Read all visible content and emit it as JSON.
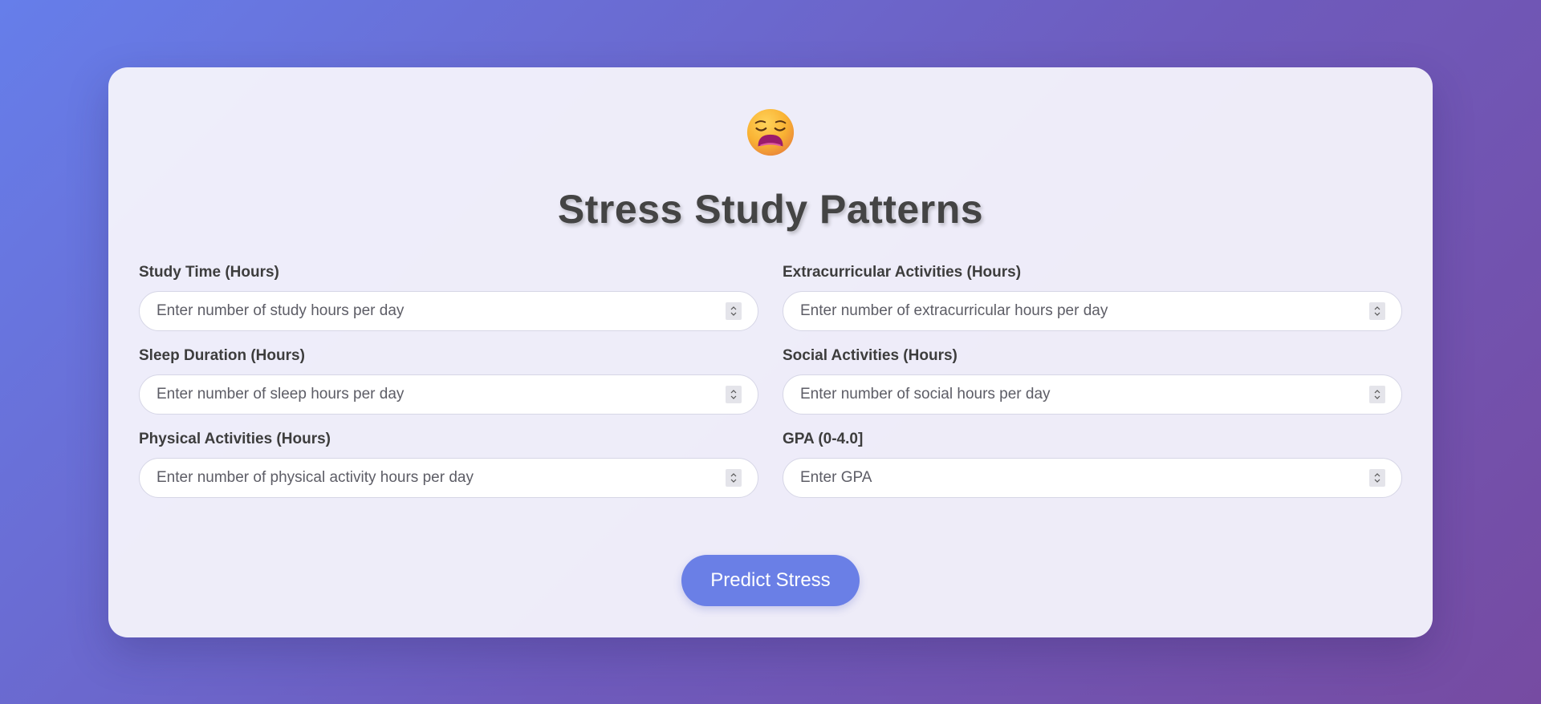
{
  "page": {
    "emoji_icon": "weary-face-icon",
    "title": "Stress Study Patterns",
    "colors": {
      "background_start": "#667eea",
      "background_end": "#764ba2",
      "button": "#6a7fe6"
    }
  },
  "form": {
    "fields": [
      {
        "label": "Study Time (Hours)",
        "placeholder": "Enter number of study hours per day",
        "value": ""
      },
      {
        "label": "Extracurricular Activities (Hours)",
        "placeholder": "Enter number of extracurricular hours per day",
        "value": ""
      },
      {
        "label": "Sleep Duration (Hours)",
        "placeholder": "Enter number of sleep hours per day",
        "value": ""
      },
      {
        "label": "Social Activities (Hours)",
        "placeholder": "Enter number of social hours per day",
        "value": ""
      },
      {
        "label": "Physical Activities (Hours)",
        "placeholder": "Enter number of physical activity hours per day",
        "value": ""
      },
      {
        "label": "GPA (0-4.0]",
        "placeholder": "Enter GPA",
        "value": ""
      }
    ],
    "submit_label": "Predict Stress"
  }
}
